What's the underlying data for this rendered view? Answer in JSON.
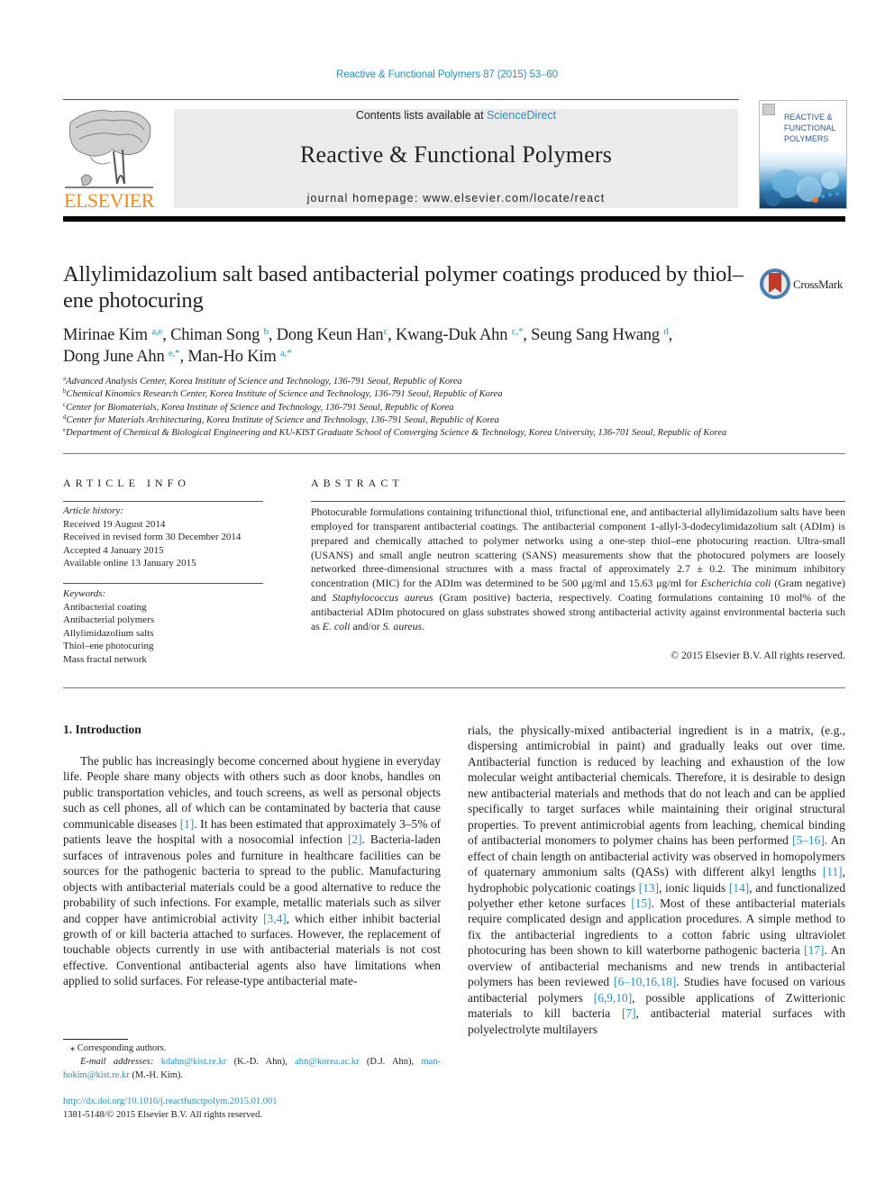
{
  "running_head": "Reactive & Functional Polymers 87 (2015) 53–60",
  "publisher": {
    "logo_text": "ELSEVIER",
    "logo_color": "#f08a1c",
    "link_color": "#2a8fbd"
  },
  "banner": {
    "contents_prefix": "Contents lists available at ",
    "contents_link": "ScienceDirect",
    "journal_title": "Reactive & Functional Polymers",
    "homepage_label": "journal homepage: ",
    "homepage_url": "www.elsevier.com/locate/react"
  },
  "cover": {
    "lines": [
      "REACTIVE &",
      "FUNCTIONAL",
      "POLYMERS"
    ]
  },
  "article": {
    "title": "Allylimidazolium salt based antibacterial polymer coatings produced by thiol–ene photocuring",
    "crossmark_label": "CrossMark",
    "authors": [
      {
        "name": "Mirinae Kim",
        "sup": "a,e",
        "sep": ", "
      },
      {
        "name": "Chiman Song",
        "sup": "b",
        "sep": ", "
      },
      {
        "name": "Dong Keun Han",
        "sup": "c",
        "sep": ", "
      },
      {
        "name": "Kwang-Duk Ahn",
        "sup": "c,*",
        "sep": ", "
      },
      {
        "name": "Seung Sang Hwang",
        "sup": "d",
        "sep": ","
      },
      {
        "name": "Dong June Ahn",
        "sup": "e,*",
        "sep": ", "
      },
      {
        "name": "Man-Ho Kim",
        "sup": "a,*",
        "sep": ""
      }
    ],
    "affiliations": [
      {
        "key": "a",
        "text": "Advanced Analysis Center, Korea Institute of Science and Technology, 136-791 Seoul, Republic of Korea"
      },
      {
        "key": "b",
        "text": "Chemical Kinomics Research Center, Korea Institute of Science and Technology, 136-791 Seoul, Republic of Korea"
      },
      {
        "key": "c",
        "text": "Center for Biomaterials, Korea Institute of Science and Technology, 136-791 Seoul, Republic of Korea"
      },
      {
        "key": "d",
        "text": "Center for Materials Architecturing, Korea Institute of Science and Technology, 136-791 Seoul, Republic of Korea"
      },
      {
        "key": "e",
        "text": "Department of Chemical & Biological Engineering and KU-KIST Graduate School of Converging Science & Technology, Korea University, 136-701 Seoul, Republic of Korea"
      }
    ]
  },
  "article_info": {
    "heading": "ARTICLE INFO",
    "history_label": "Article history:",
    "history": [
      "Received 19 August 2014",
      "Received in revised form 30 December 2014",
      "Accepted 4 January 2015",
      "Available online 13 January 2015"
    ],
    "keywords_label": "Keywords:",
    "keywords": [
      "Antibacterial coating",
      "Antibacterial polymers",
      "Allylimidazolium salts",
      "Thiol–ene photocuring",
      "Mass fractal network"
    ]
  },
  "abstract": {
    "heading": "ABSTRACT",
    "segments": [
      {
        "t": "Photocurable formulations containing trifunctional thiol, trifunctional ene, and antibacterial allylimidazolium salts have been employed for transparent antibacterial coatings. The antibacterial component 1-allyl-3-dodecylimidazolium salt (ADIm) is prepared and chemically attached to polymer networks using a one-step thiol–ene photocuring reaction. Ultra-small (USANS) and small angle neutron scattering (SANS) measurements show that the photocured polymers are loosely networked three-dimensional structures with a mass fractal of approximately 2.7 ± 0.2. The minimum inhibitory concentration (MIC) for the ADIm was determined to be 500 μg/ml and 15.63 μg/ml for "
      },
      {
        "t": "Escherichia coli",
        "i": true
      },
      {
        "t": " (Gram negative) and "
      },
      {
        "t": "Staphylococcus aureus",
        "i": true
      },
      {
        "t": " (Gram positive) bacteria, respectively. Coating formulations containing 10 mol% of the antibacterial ADIm photocured on glass substrates showed strong antibacterial activity against environmental bacteria such as "
      },
      {
        "t": "E. coli",
        "i": true
      },
      {
        "t": " and/or "
      },
      {
        "t": "S. aureus",
        "i": true
      },
      {
        "t": "."
      }
    ],
    "copyright": "© 2015 Elsevier B.V. All rights reserved."
  },
  "body": {
    "section_heading": "1. Introduction",
    "left_column": [
      {
        "t": "The public has increasingly become concerned about hygiene in everyday life. People share many objects with others such as door knobs, handles on public transportation vehicles, and touch screens, as well as personal objects such as cell phones, all of which can be contaminated by bacteria that cause communicable diseases "
      },
      {
        "t": "[1]",
        "ref": true
      },
      {
        "t": ". It has been estimated that approximately 3–5% of patients leave the hospital with a nosocomial infection "
      },
      {
        "t": "[2]",
        "ref": true
      },
      {
        "t": ". Bacteria-laden surfaces of intravenous poles and furniture in healthcare facilities can be sources for the pathogenic bacteria to spread to the public. Manufacturing objects with antibacterial materials could be a good alternative to reduce the probability of such infections. For example, metallic materials such as silver and copper have antimicrobial activity "
      },
      {
        "t": "[3,4]",
        "ref": true
      },
      {
        "t": ", which either inhibit bacterial growth of or kill bacteria attached to surfaces. However, the replacement of touchable objects currently in use with antibacterial materials is not cost effective. Conventional antibacterial agents also have limitations when applied to solid surfaces. For release-type antibacterial mate-"
      }
    ],
    "right_column": [
      {
        "t": "rials, the physically-mixed antibacterial ingredient is in a matrix, (e.g., dispersing antimicrobial in paint) and gradually leaks out over time. Antibacterial function is reduced by leaching and exhaustion of the low molecular weight antibacterial chemicals. Therefore, it is desirable to design new antibacterial materials and methods that do not leach and can be applied specifically to target surfaces while maintaining their original structural properties. To prevent antimicrobial agents from leaching, chemical binding of antibacterial monomers to polymer chains has been performed "
      },
      {
        "t": "[5–16]",
        "ref": true
      },
      {
        "t": ". An effect of chain length on antibacterial activity was observed in homopolymers of quaternary ammonium salts (QASs) with different alkyl lengths "
      },
      {
        "t": "[11]",
        "ref": true
      },
      {
        "t": ", hydrophobic polycationic coatings "
      },
      {
        "t": "[13]",
        "ref": true
      },
      {
        "t": ", ionic liquids "
      },
      {
        "t": "[14]",
        "ref": true
      },
      {
        "t": ", and functionalized polyether ether ketone surfaces "
      },
      {
        "t": "[15]",
        "ref": true
      },
      {
        "t": ". Most of these antibacterial materials require complicated design and application procedures. A simple method to fix the antibacterial ingredients to a cotton fabric using ultraviolet photocuring has been shown to kill waterborne pathogenic bacteria "
      },
      {
        "t": "[17]",
        "ref": true
      },
      {
        "t": ". An overview of antibacterial mechanisms and new trends in antibacterial polymers has been reviewed "
      },
      {
        "t": "[6–10,16,18]",
        "ref": true
      },
      {
        "t": ". Studies have focused on various antibacterial polymers "
      },
      {
        "t": "[6,9,10]",
        "ref": true
      },
      {
        "t": ", possible applications of Zwitterionic materials to kill bacteria "
      },
      {
        "t": "[7]",
        "ref": true
      },
      {
        "t": ", antibacterial material surfaces with polyelectrolyte multilayers"
      }
    ]
  },
  "footnotes": {
    "corresponding": "Corresponding authors.",
    "email_label": "E-mail addresses:",
    "emails": [
      {
        "email": "kdahn@kist.re.kr",
        "who": "(K.-D. Ahn)"
      },
      {
        "email": "ahn@korea.ac.kr",
        "who": "(D.J. Ahn)"
      },
      {
        "email": "man-hokim@kist.re.kr",
        "who": "(M.-H. Kim)."
      }
    ],
    "doi": "http://dx.doi.org/10.1016/j.reactfunctpolym.2015.01.001",
    "issn": "1381-5148/© 2015 Elsevier B.V. All rights reserved."
  }
}
